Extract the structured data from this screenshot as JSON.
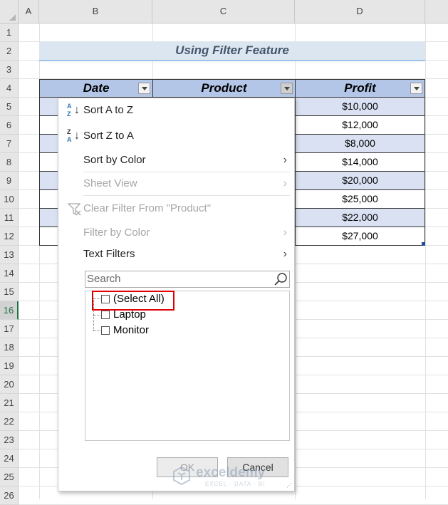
{
  "sheet": {
    "columns": [
      "A",
      "B",
      "C",
      "D"
    ],
    "rows": [
      "1",
      "2",
      "3",
      "4",
      "5",
      "6",
      "7",
      "8",
      "9",
      "10",
      "11",
      "12",
      "13",
      "14",
      "15",
      "16",
      "17",
      "18",
      "19",
      "20",
      "21",
      "22",
      "23",
      "24",
      "25",
      "26"
    ],
    "active_row": "16",
    "title": "Using Filter Feature",
    "headers": {
      "date": "Date",
      "product": "Product",
      "profit": "Profit"
    },
    "profits": [
      "$10,000",
      "$12,000",
      "$8,000",
      "$14,000",
      "$20,000",
      "$25,000",
      "$22,000",
      "$27,000"
    ]
  },
  "filter_menu": {
    "sort_az": {
      "label": "Sort A to Z",
      "icon": "sort-a-to-z-icon",
      "icon_top": "A",
      "icon_bottom": "Z"
    },
    "sort_za": {
      "label": "Sort Z to A",
      "icon": "sort-z-to-a-icon",
      "icon_top": "Z",
      "icon_bottom": "A"
    },
    "sort_by_color": "Sort by Color",
    "sheet_view": "Sheet View",
    "clear_filter": "Clear Filter From \"Product\"",
    "filter_by_color": "Filter by Color",
    "text_filters": "Text Filters",
    "search_placeholder": "Search",
    "items": [
      "(Select All)",
      "Laptop",
      "Monitor"
    ],
    "ok_label": "OK",
    "cancel_label": "Cancel"
  },
  "watermark": {
    "name": "exceldemy",
    "tagline": "EXCEL · DATA · BI"
  },
  "colors": {
    "header_fill": "#b4c6e7",
    "band_fill": "#d9e1f2",
    "title_fill": "#dce6f1",
    "highlight": "#e00000",
    "active_row": "#217346"
  }
}
